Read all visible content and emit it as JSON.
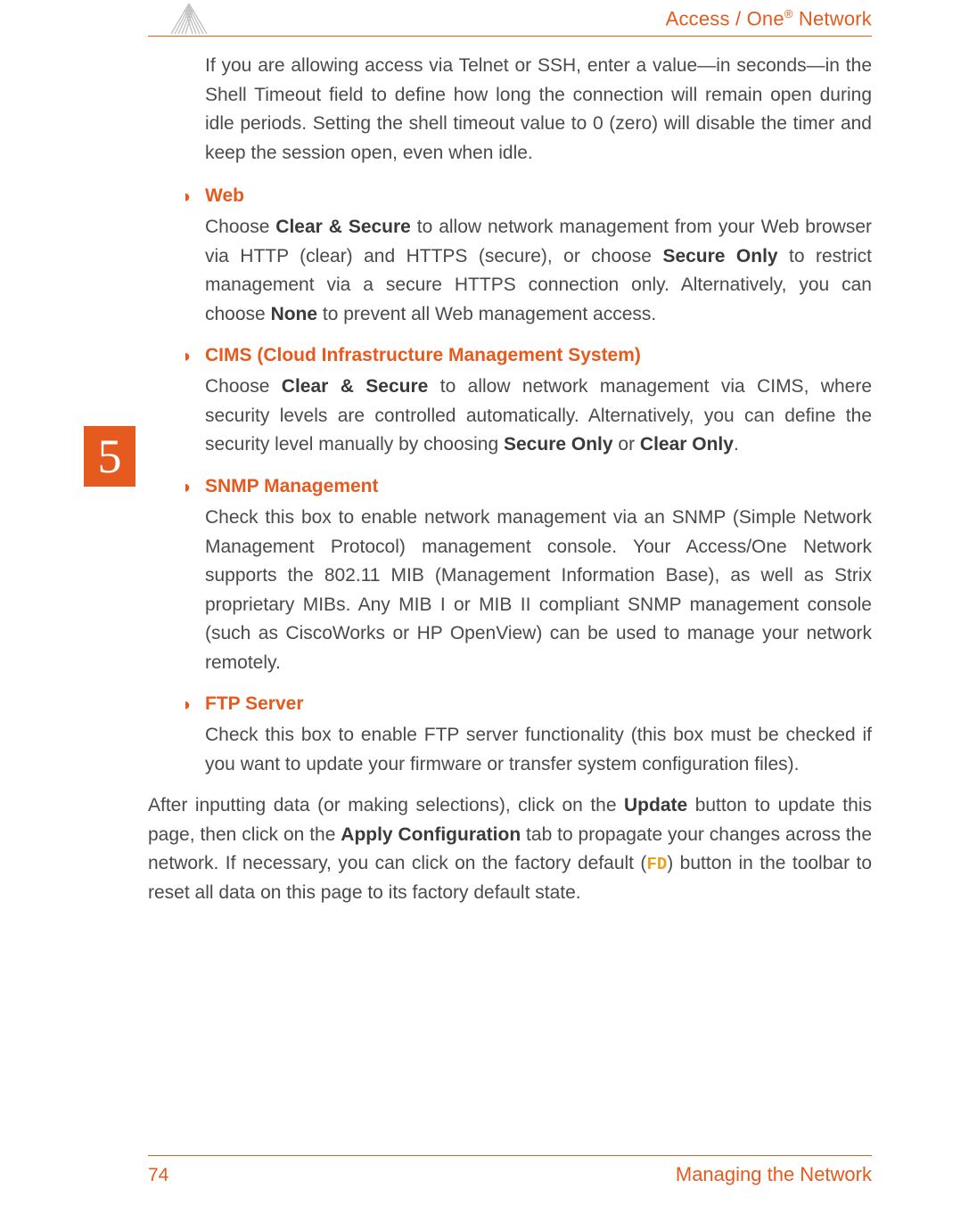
{
  "header": {
    "brand_prefix": "Access / One",
    "brand_sup": "®",
    "brand_suffix": " Network"
  },
  "chapter": {
    "number": "5"
  },
  "intro_para": "If you are allowing access via Telnet or SSH, enter a value—in seconds—in the Shell Timeout field to define how long the connection will remain open during idle periods. Setting the shell timeout value to 0 (zero) will disable the timer and keep the session open, even when idle.",
  "bullets": {
    "web": {
      "heading": "Web",
      "body_parts": {
        "t1": "Choose ",
        "b1": "Clear & Secure",
        "t2": " to allow network management from your Web browser via HTTP (clear) and HTTPS (secure), or choose ",
        "b2": "Secure Only",
        "t3": " to restrict management via a secure HTTPS connection only. Alternatively, you can choose ",
        "b3": "None",
        "t4": " to prevent all Web management access."
      }
    },
    "cims": {
      "heading": "CIMS (Cloud Infrastructure Management System)",
      "body_parts": {
        "t1": "Choose ",
        "b1": "Clear & Secure",
        "t2": " to allow network management via CIMS, where security levels are controlled automatically. Alternatively, you can define the security level manually by choosing ",
        "b2": "Secure Only",
        "t3": " or ",
        "b3": "Clear Only",
        "t4": "."
      }
    },
    "snmp": {
      "heading": "SNMP Management",
      "body": "Check this box to enable network management via an SNMP (Simple Network Management Protocol) management console. Your Access/One Network supports the 802.11 MIB (Management Information Base), as well as Strix proprietary MIBs. Any MIB I or MIB II compliant SNMP management console (such as CiscoWorks or HP OpenView) can be used to manage your network remotely."
    },
    "ftp": {
      "heading": "FTP Server",
      "body": "Check this box to enable FTP server functionality (this box must be checked if you want to update your firmware or transfer system configuration files)."
    }
  },
  "closing_parts": {
    "t1": "After inputting data (or making selections), click on the ",
    "b1": "Update",
    "t2": " button to update this page, then click on the ",
    "b2": "Apply Configuration",
    "t3": " tab to propagate your changes across the network. If necessary, you can click on the factory default (",
    "fd": "FD",
    "t4": ") button in the toolbar to reset all data on this page to its factory default state."
  },
  "footer": {
    "page_number": "74",
    "title": "Managing the Network"
  }
}
